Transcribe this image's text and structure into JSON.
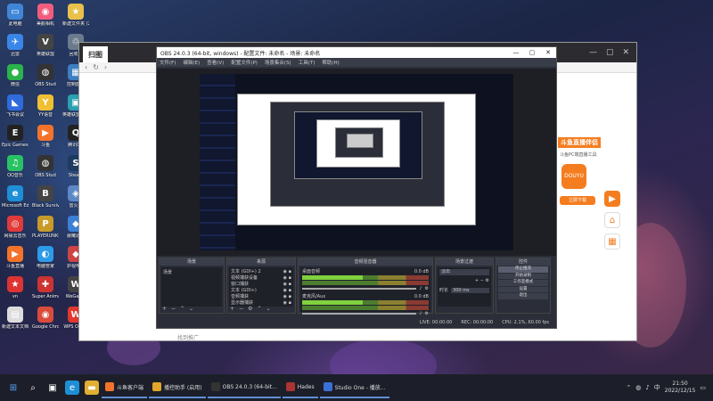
{
  "desktop_icons": [
    {
      "label": "此电脑",
      "glyph": "▭",
      "color": "#3f85d8"
    },
    {
      "label": "美颜相机",
      "glyph": "◉",
      "color": "#f25c7e"
    },
    {
      "label": "新建文件夹 (2)",
      "glyph": "★",
      "color": "#e8c04a"
    },
    {
      "label": "迅雷",
      "glyph": "✈",
      "color": "#3a86e8"
    },
    {
      "label": "英雄联盟",
      "glyph": "V",
      "color": "#444"
    },
    {
      "label": "回收站",
      "glyph": "♲",
      "color": "#6b7a8c"
    },
    {
      "label": "微信",
      "glyph": "●",
      "color": "#2ab34a"
    },
    {
      "label": "OBS Stud",
      "glyph": "◍",
      "color": "#333"
    },
    {
      "label": "控制面板",
      "glyph": "▦",
      "color": "#3d7fc0"
    },
    {
      "label": "飞书会议",
      "glyph": "◣",
      "color": "#2f6bdc"
    },
    {
      "label": "YY语音",
      "glyph": "Y",
      "color": "#f0c034"
    },
    {
      "label": "英雄联盟WeGame",
      "glyph": "▣",
      "color": "#2aa0b0"
    },
    {
      "label": "Epic Games Launcher",
      "glyph": "E",
      "color": "#222"
    },
    {
      "label": "斗鱼",
      "glyph": "▶",
      "color": "#f4732a"
    },
    {
      "label": "腾讯QQ",
      "glyph": "Q",
      "color": "#222"
    },
    {
      "label": "QQ音乐",
      "glyph": "♫",
      "color": "#28c265"
    },
    {
      "label": "OBS Stud",
      "glyph": "◍",
      "color": "#333"
    },
    {
      "label": "Steam",
      "glyph": "S",
      "color": "#1d3b5e"
    },
    {
      "label": "Microsoft Edge",
      "glyph": "e",
      "color": "#1e8fd6"
    },
    {
      "label": "Black Survival",
      "glyph": "B",
      "color": "#444"
    },
    {
      "label": "雷火样",
      "glyph": "◈",
      "color": "#5d88c8"
    },
    {
      "label": "网易云音乐",
      "glyph": "◎",
      "color": "#e03a3a"
    },
    {
      "label": "PLAYERUNKNOWN'S BATTLEGROUNDS",
      "glyph": "P",
      "color": "#c79a2a"
    },
    {
      "label": "晨曦通道",
      "glyph": "◆",
      "color": "#3b7fd6"
    },
    {
      "label": "斗鱼直播",
      "glyph": "▶",
      "color": "#f4732a"
    },
    {
      "label": "电脑管家",
      "glyph": "◐",
      "color": "#2d9be8"
    },
    {
      "label": "护视电脑",
      "glyph": "◆",
      "color": "#c44"
    },
    {
      "label": "vn",
      "glyph": "★",
      "color": "#d33"
    },
    {
      "label": "Super Animal Ro...",
      "glyph": "✚",
      "color": "#c33"
    },
    {
      "label": "WeGame",
      "glyph": "W",
      "color": "#444"
    },
    {
      "label": "新建文本文档",
      "glyph": "▤",
      "color": "#ddd"
    },
    {
      "label": "Google Chrome",
      "glyph": "◉",
      "color": "#d94b3b"
    },
    {
      "label": "WPS Office",
      "glyph": "W",
      "color": "#e1382d"
    }
  ],
  "browser": {
    "tab_title": "扫图",
    "footer_text": "找到推广",
    "side_widget": {
      "title": "斗鱼直播伴侣",
      "logo_text": "DOUYU",
      "button": "立即下载",
      "desc": "斗鱼PC端直播工具"
    }
  },
  "obs": {
    "title": "OBS 24.0.3 (64-bit, windows) - 配置文件: 未命名 - 场景: 未命名",
    "menus": [
      "文件(F)",
      "编辑(E)",
      "查看(V)",
      "配置文件(P)",
      "场景集合(S)",
      "工具(T)",
      "帮助(H)"
    ],
    "docks": {
      "scenes": {
        "title": "场景",
        "items": [
          "场景"
        ]
      },
      "sources": {
        "title": "来源",
        "items": [
          "文本 (GDI+) 2",
          "视频捕获设备",
          "窗口捕获",
          "文本 (GDI+)",
          "音频捕获",
          "显示器捕获"
        ]
      },
      "mixer": {
        "title": "音频混音器",
        "channels": [
          {
            "name": "桌面音频",
            "db": "0.0 dB"
          },
          {
            "name": "麦克风/Aux",
            "db": "0.0 dB"
          }
        ]
      },
      "transitions": {
        "title": "场景过渡",
        "type": "淡出",
        "duration_label": "时长",
        "duration": "300 ms"
      },
      "controls": {
        "title": "控件",
        "buttons": [
          "停止推流",
          "开始录制",
          "工作室模式",
          "设置",
          "退出"
        ]
      }
    },
    "status": [
      "LIVE: 00:00:00",
      "REC: 00:00:00",
      "CPU: 2.1%, 60.00 fps"
    ]
  },
  "taskbar": {
    "apps": [
      {
        "label": "斗鱼客户端",
        "color": "#f4732a"
      },
      {
        "label": "播控助手 (启用)",
        "color": "#e0a52a"
      },
      {
        "label": "OBS 24.0.3 (64-bit...",
        "color": "#333"
      },
      {
        "label": "Hades",
        "color": "#a33"
      },
      {
        "label": "Studio One - 播放...",
        "color": "#3a6fd6"
      }
    ],
    "time": "21:50",
    "date": "2022/12/15"
  }
}
